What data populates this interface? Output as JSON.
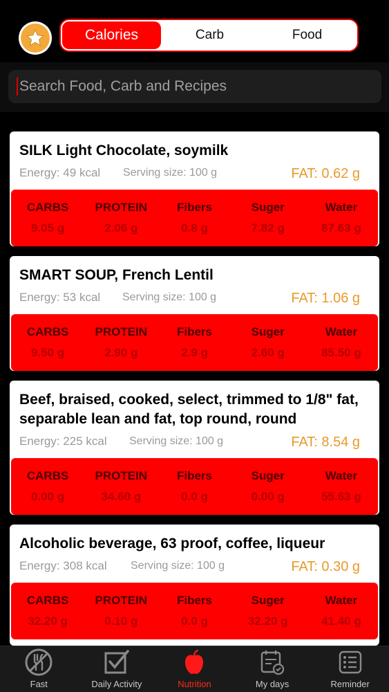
{
  "segments": {
    "tabs": [
      "Calories",
      "Carb",
      "Food"
    ],
    "active": "Calories"
  },
  "search": {
    "placeholder": "Search Food, Carb and Recipes"
  },
  "foods": [
    {
      "name": "SILK Light Chocolate, soymilk",
      "energy": "Energy: 49 kcal",
      "serving": "Serving size: 100 g",
      "fat": "FAT: 0.62 g",
      "nutrients": [
        {
          "label": "CARBS",
          "value": "9.05 g"
        },
        {
          "label": "PROTEIN",
          "value": "2.06 g"
        },
        {
          "label": "Fibers",
          "value": "0.8 g"
        },
        {
          "label": "Suger",
          "value": "7.82 g"
        },
        {
          "label": "Water",
          "value": "87.63 g"
        }
      ]
    },
    {
      "name": "SMART SOUP, French Lentil",
      "energy": "Energy: 53 kcal",
      "serving": "Serving size: 100 g",
      "fat": "FAT: 1.06 g",
      "nutrients": [
        {
          "label": "CARBS",
          "value": "9.50 g"
        },
        {
          "label": "PROTEIN",
          "value": "2.90 g"
        },
        {
          "label": "Fibers",
          "value": "2.9 g"
        },
        {
          "label": "Suger",
          "value": "2.60 g"
        },
        {
          "label": "Water",
          "value": "85.50 g"
        }
      ]
    },
    {
      "name": "Beef, braised, cooked, select, trimmed to 1/8\" fat, separable lean and fat, top round, round",
      "energy": "Energy: 225 kcal",
      "serving": "Serving size: 100 g",
      "fat": "FAT: 8.54 g",
      "nutrients": [
        {
          "label": "CARBS",
          "value": "0.00 g"
        },
        {
          "label": "PROTEIN",
          "value": "34.60 g"
        },
        {
          "label": "Fibers",
          "value": "0.0 g"
        },
        {
          "label": "Suger",
          "value": "0.00 g"
        },
        {
          "label": "Water",
          "value": "55.63 g"
        }
      ]
    },
    {
      "name": "Alcoholic beverage, 63 proof, coffee, liqueur",
      "energy": "Energy: 308 kcal",
      "serving": "Serving size: 100 g",
      "fat": "FAT: 0.30 g",
      "nutrients": [
        {
          "label": "CARBS",
          "value": "32.20 g"
        },
        {
          "label": "PROTEIN",
          "value": "0.10 g"
        },
        {
          "label": "Fibers",
          "value": "0.0 g"
        },
        {
          "label": "Suger",
          "value": "32.20 g"
        },
        {
          "label": "Water",
          "value": "41.40 g"
        }
      ]
    }
  ],
  "tabbar": [
    {
      "label": "Fast",
      "icon": "fast-icon"
    },
    {
      "label": "Daily Activity",
      "icon": "checklist-icon"
    },
    {
      "label": "Nutrition",
      "icon": "apple-icon"
    },
    {
      "label": "My days",
      "icon": "calendar-icon"
    },
    {
      "label": "Reminder",
      "icon": "reminder-list-icon"
    }
  ],
  "colors": {
    "accent": "#ff0000",
    "fat": "#e89a2c",
    "star": "#f3a93a"
  }
}
